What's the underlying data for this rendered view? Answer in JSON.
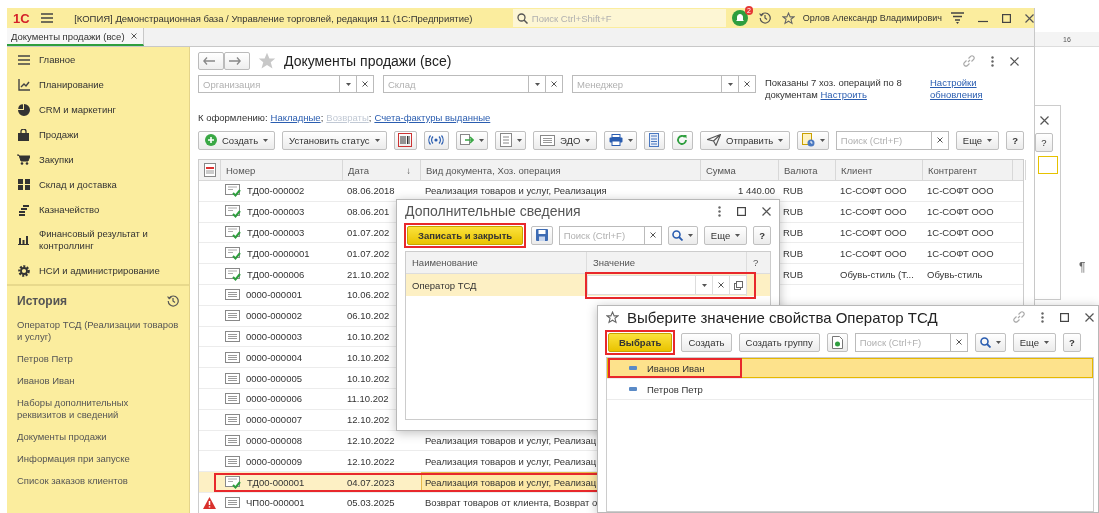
{
  "window": {
    "logo": "1С",
    "title": "[КОПИЯ] Демонстрационная база / Управление торговлей, редакция 11  (1С:Предприятие)",
    "search_placeholder": "Поиск Ctrl+Shift+F",
    "notifications": "2",
    "user": "Орлов Александр Владимирович"
  },
  "tabs": [
    {
      "label": "Документы продажи (все)",
      "selected": true
    }
  ],
  "sidebar": {
    "sections": [
      "Главное",
      "Планирование",
      "CRM и маркетинг",
      "Продажи",
      "Закупки",
      "Склад и доставка",
      "Казначейство",
      "Финансовый результат и контроллинг",
      "НСИ и администрирование"
    ],
    "history_title": "История",
    "history": [
      "Оператор ТСД (Реализации товаров и услуг)",
      "Петров Петр",
      "Иванов Иван",
      "Наборы дополнительных реквизитов и сведений",
      "Документы продажи",
      "Информация при запуске",
      "Список заказов клиентов"
    ]
  },
  "form": {
    "title": "Документы продажи (все)",
    "filters": [
      {
        "placeholder": "Организация"
      },
      {
        "placeholder": "Склад"
      },
      {
        "placeholder": "Менеджер"
      }
    ],
    "summary": "Показаны 7 хоз. операций по 8 документам",
    "summary_link": "Настроить",
    "refresh_link": "Настройки обновления",
    "todo_label": "К оформлению:",
    "separator": ";",
    "todo_links": [
      {
        "label": "Накладные",
        "disabled": false
      },
      {
        "label": "Возвраты",
        "disabled": true
      },
      {
        "label": "Счета-фактуры выданные",
        "disabled": false
      }
    ],
    "toolbar": [
      {
        "kind": "button",
        "label": "Создать",
        "dropdown": true
      },
      {
        "kind": "button",
        "label": "Установить статус",
        "dropdown": true
      },
      {
        "kind": "icon",
        "dropdown": false
      },
      {
        "kind": "icon",
        "dropdown": false
      },
      {
        "kind": "icon",
        "dropdown": true
      },
      {
        "kind": "icon",
        "dropdown": true
      },
      {
        "kind": "button",
        "label": "ЭДО",
        "dropdown": true
      },
      {
        "kind": "icon",
        "dropdown": true
      },
      {
        "kind": "icon",
        "dropdown": false
      },
      {
        "kind": "icon",
        "dropdown": false
      },
      {
        "kind": "button",
        "label": "Отправить",
        "dropdown": true
      },
      {
        "kind": "icon",
        "dropdown": true
      },
      {
        "kind": "search",
        "placeholder": "Поиск (Ctrl+F)"
      },
      {
        "kind": "button",
        "label": "Еще",
        "dropdown": true
      },
      {
        "kind": "help",
        "label": "?",
        "dropdown": false
      }
    ]
  },
  "table": {
    "columns": [
      {
        "label": "Номер"
      },
      {
        "label": "Дата",
        "sort": "↓"
      },
      {
        "label": "Вид документа, Хоз. операция"
      },
      {
        "label": "Сумма"
      },
      {
        "label": "Валюта"
      },
      {
        "label": "Клиент"
      },
      {
        "label": "Контрагент"
      }
    ],
    "rows": [
      {
        "kind": "posted",
        "warning": false,
        "selected": false,
        "highlighted": false,
        "number": "ТД00-000002",
        "date": "08.06.2018",
        "operation": "Реализация товаров и услуг, Реализация",
        "sum": "1 440.00",
        "currency": "RUB",
        "client": "1С-СОФТ ООО",
        "counterparty": "1С-СОФТ ООО"
      },
      {
        "kind": "posted",
        "warning": false,
        "selected": false,
        "highlighted": false,
        "number": "ТД00-000003",
        "date": "08.06.201",
        "currency": "RUB",
        "client": "1С-СОФТ ООО",
        "counterparty": "1С-СОФТ ООО"
      },
      {
        "kind": "posted",
        "warning": false,
        "selected": false,
        "highlighted": false,
        "number": "ТД00-000003",
        "date": "01.07.202",
        "currency": "RUB",
        "client": "1С-СОФТ ООО",
        "counterparty": "1С-СОФТ ООО"
      },
      {
        "kind": "posted",
        "warning": false,
        "selected": false,
        "highlighted": false,
        "number": "ТД00-0000001",
        "date": "01.07.202",
        "currency": "RUB",
        "client": "1С-СОФТ ООО",
        "counterparty": "1С-СОФТ ООО"
      },
      {
        "kind": "posted",
        "warning": false,
        "selected": false,
        "highlighted": false,
        "number": "ТД00-000006",
        "date": "21.10.202",
        "currency": "RUB",
        "client": "Обувь-стиль (Т...",
        "counterparty": "Обувь-стиль"
      },
      {
        "kind": "draft",
        "warning": false,
        "selected": false,
        "highlighted": false,
        "number": "0000-000001",
        "date": "10.06.202"
      },
      {
        "kind": "draft",
        "warning": false,
        "selected": false,
        "highlighted": false,
        "number": "0000-000002",
        "date": "06.10.202"
      },
      {
        "kind": "draft",
        "warning": false,
        "selected": false,
        "highlighted": false,
        "number": "0000-000003",
        "date": "10.10.202"
      },
      {
        "kind": "draft",
        "warning": false,
        "selected": false,
        "highlighted": false,
        "number": "0000-000004",
        "date": "10.10.202"
      },
      {
        "kind": "draft",
        "warning": false,
        "selected": false,
        "highlighted": false,
        "number": "0000-000005",
        "date": "10.10.202"
      },
      {
        "kind": "draft",
        "warning": false,
        "selected": false,
        "highlighted": false,
        "number": "0000-000006",
        "date": "11.10.202"
      },
      {
        "kind": "draft",
        "warning": false,
        "selected": false,
        "highlighted": false,
        "number": "0000-000007",
        "date": "12.10.202"
      },
      {
        "kind": "draft",
        "warning": false,
        "selected": false,
        "highlighted": false,
        "number": "0000-000008",
        "date": "12.10.2022",
        "operation": "Реализация товаров и услуг, Реализац"
      },
      {
        "kind": "draft",
        "warning": false,
        "selected": false,
        "highlighted": false,
        "number": "0000-000009",
        "date": "12.10.2022",
        "operation": "Реализация товаров и услуг, Реализац"
      },
      {
        "kind": "posted",
        "warning": false,
        "selected": true,
        "highlighted": true,
        "number": "ТД00-000001",
        "date": "04.07.2023",
        "operation": "Реализация товаров и услуг, Реализац"
      },
      {
        "kind": "draft",
        "warning": true,
        "selected": false,
        "highlighted": false,
        "number": "ЧП00-000001",
        "date": "05.03.2025",
        "operation": "Возврат товаров от клиента, Возврат о"
      }
    ]
  },
  "dialog": {
    "title": "Дополнительные сведения",
    "toolbar": [
      {
        "kind": "primary",
        "label": "Записать и закрыть",
        "dropdown": false,
        "highlighted": true
      },
      {
        "kind": "icon",
        "dropdown": false
      },
      {
        "kind": "search",
        "placeholder": "Поиск (Ctrl+F)"
      },
      {
        "kind": "icon",
        "dropdown": true
      },
      {
        "kind": "button",
        "label": "Еще",
        "dropdown": true
      },
      {
        "kind": "help",
        "label": "?",
        "dropdown": false
      }
    ],
    "columns": [
      "Наименование",
      "Значение",
      "?"
    ],
    "rows": [
      {
        "name": "Оператор ТСД",
        "selected": true,
        "highlighted": true
      }
    ]
  },
  "popup": {
    "title": "Выберите значение свойства Оператор ТСД",
    "toolbar": [
      {
        "kind": "primary",
        "label": "Выбрать",
        "dropdown": false,
        "highlighted": true
      },
      {
        "kind": "button",
        "label": "Создать",
        "dropdown": false
      },
      {
        "kind": "button",
        "label": "Создать группу",
        "dropdown": false
      },
      {
        "kind": "icon",
        "dropdown": false
      },
      {
        "kind": "search",
        "placeholder": "Поиск (Ctrl+F)"
      },
      {
        "kind": "icon",
        "dropdown": true
      },
      {
        "kind": "button",
        "label": "Еще",
        "dropdown": true
      },
      {
        "kind": "help",
        "label": "?",
        "dropdown": false
      }
    ],
    "items": [
      {
        "label": "Иванов Иван",
        "selected": true,
        "highlighted": true
      },
      {
        "label": "Петров Петр",
        "selected": false,
        "highlighted": false
      }
    ]
  },
  "document": {
    "ruler_mark": "16",
    "help": "?",
    "pilcrow": "¶"
  }
}
